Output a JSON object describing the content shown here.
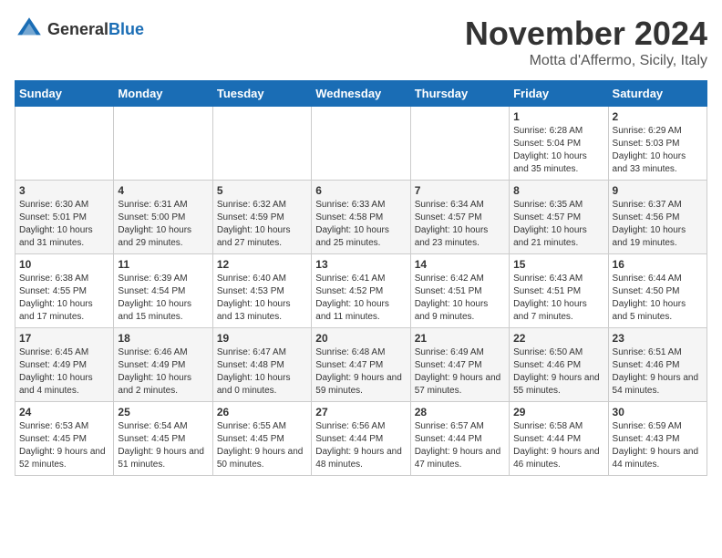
{
  "header": {
    "logo_general": "General",
    "logo_blue": "Blue",
    "month_title": "November 2024",
    "location": "Motta d'Affermo, Sicily, Italy"
  },
  "days_of_week": [
    "Sunday",
    "Monday",
    "Tuesday",
    "Wednesday",
    "Thursday",
    "Friday",
    "Saturday"
  ],
  "weeks": [
    [
      {
        "day": "",
        "sunrise": "",
        "sunset": "",
        "daylight": ""
      },
      {
        "day": "",
        "sunrise": "",
        "sunset": "",
        "daylight": ""
      },
      {
        "day": "",
        "sunrise": "",
        "sunset": "",
        "daylight": ""
      },
      {
        "day": "",
        "sunrise": "",
        "sunset": "",
        "daylight": ""
      },
      {
        "day": "",
        "sunrise": "",
        "sunset": "",
        "daylight": ""
      },
      {
        "day": "1",
        "sunrise": "Sunrise: 6:28 AM",
        "sunset": "Sunset: 5:04 PM",
        "daylight": "Daylight: 10 hours and 35 minutes."
      },
      {
        "day": "2",
        "sunrise": "Sunrise: 6:29 AM",
        "sunset": "Sunset: 5:03 PM",
        "daylight": "Daylight: 10 hours and 33 minutes."
      }
    ],
    [
      {
        "day": "3",
        "sunrise": "Sunrise: 6:30 AM",
        "sunset": "Sunset: 5:01 PM",
        "daylight": "Daylight: 10 hours and 31 minutes."
      },
      {
        "day": "4",
        "sunrise": "Sunrise: 6:31 AM",
        "sunset": "Sunset: 5:00 PM",
        "daylight": "Daylight: 10 hours and 29 minutes."
      },
      {
        "day": "5",
        "sunrise": "Sunrise: 6:32 AM",
        "sunset": "Sunset: 4:59 PM",
        "daylight": "Daylight: 10 hours and 27 minutes."
      },
      {
        "day": "6",
        "sunrise": "Sunrise: 6:33 AM",
        "sunset": "Sunset: 4:58 PM",
        "daylight": "Daylight: 10 hours and 25 minutes."
      },
      {
        "day": "7",
        "sunrise": "Sunrise: 6:34 AM",
        "sunset": "Sunset: 4:57 PM",
        "daylight": "Daylight: 10 hours and 23 minutes."
      },
      {
        "day": "8",
        "sunrise": "Sunrise: 6:35 AM",
        "sunset": "Sunset: 4:57 PM",
        "daylight": "Daylight: 10 hours and 21 minutes."
      },
      {
        "day": "9",
        "sunrise": "Sunrise: 6:37 AM",
        "sunset": "Sunset: 4:56 PM",
        "daylight": "Daylight: 10 hours and 19 minutes."
      }
    ],
    [
      {
        "day": "10",
        "sunrise": "Sunrise: 6:38 AM",
        "sunset": "Sunset: 4:55 PM",
        "daylight": "Daylight: 10 hours and 17 minutes."
      },
      {
        "day": "11",
        "sunrise": "Sunrise: 6:39 AM",
        "sunset": "Sunset: 4:54 PM",
        "daylight": "Daylight: 10 hours and 15 minutes."
      },
      {
        "day": "12",
        "sunrise": "Sunrise: 6:40 AM",
        "sunset": "Sunset: 4:53 PM",
        "daylight": "Daylight: 10 hours and 13 minutes."
      },
      {
        "day": "13",
        "sunrise": "Sunrise: 6:41 AM",
        "sunset": "Sunset: 4:52 PM",
        "daylight": "Daylight: 10 hours and 11 minutes."
      },
      {
        "day": "14",
        "sunrise": "Sunrise: 6:42 AM",
        "sunset": "Sunset: 4:51 PM",
        "daylight": "Daylight: 10 hours and 9 minutes."
      },
      {
        "day": "15",
        "sunrise": "Sunrise: 6:43 AM",
        "sunset": "Sunset: 4:51 PM",
        "daylight": "Daylight: 10 hours and 7 minutes."
      },
      {
        "day": "16",
        "sunrise": "Sunrise: 6:44 AM",
        "sunset": "Sunset: 4:50 PM",
        "daylight": "Daylight: 10 hours and 5 minutes."
      }
    ],
    [
      {
        "day": "17",
        "sunrise": "Sunrise: 6:45 AM",
        "sunset": "Sunset: 4:49 PM",
        "daylight": "Daylight: 10 hours and 4 minutes."
      },
      {
        "day": "18",
        "sunrise": "Sunrise: 6:46 AM",
        "sunset": "Sunset: 4:49 PM",
        "daylight": "Daylight: 10 hours and 2 minutes."
      },
      {
        "day": "19",
        "sunrise": "Sunrise: 6:47 AM",
        "sunset": "Sunset: 4:48 PM",
        "daylight": "Daylight: 10 hours and 0 minutes."
      },
      {
        "day": "20",
        "sunrise": "Sunrise: 6:48 AM",
        "sunset": "Sunset: 4:47 PM",
        "daylight": "Daylight: 9 hours and 59 minutes."
      },
      {
        "day": "21",
        "sunrise": "Sunrise: 6:49 AM",
        "sunset": "Sunset: 4:47 PM",
        "daylight": "Daylight: 9 hours and 57 minutes."
      },
      {
        "day": "22",
        "sunrise": "Sunrise: 6:50 AM",
        "sunset": "Sunset: 4:46 PM",
        "daylight": "Daylight: 9 hours and 55 minutes."
      },
      {
        "day": "23",
        "sunrise": "Sunrise: 6:51 AM",
        "sunset": "Sunset: 4:46 PM",
        "daylight": "Daylight: 9 hours and 54 minutes."
      }
    ],
    [
      {
        "day": "24",
        "sunrise": "Sunrise: 6:53 AM",
        "sunset": "Sunset: 4:45 PM",
        "daylight": "Daylight: 9 hours and 52 minutes."
      },
      {
        "day": "25",
        "sunrise": "Sunrise: 6:54 AM",
        "sunset": "Sunset: 4:45 PM",
        "daylight": "Daylight: 9 hours and 51 minutes."
      },
      {
        "day": "26",
        "sunrise": "Sunrise: 6:55 AM",
        "sunset": "Sunset: 4:45 PM",
        "daylight": "Daylight: 9 hours and 50 minutes."
      },
      {
        "day": "27",
        "sunrise": "Sunrise: 6:56 AM",
        "sunset": "Sunset: 4:44 PM",
        "daylight": "Daylight: 9 hours and 48 minutes."
      },
      {
        "day": "28",
        "sunrise": "Sunrise: 6:57 AM",
        "sunset": "Sunset: 4:44 PM",
        "daylight": "Daylight: 9 hours and 47 minutes."
      },
      {
        "day": "29",
        "sunrise": "Sunrise: 6:58 AM",
        "sunset": "Sunset: 4:44 PM",
        "daylight": "Daylight: 9 hours and 46 minutes."
      },
      {
        "day": "30",
        "sunrise": "Sunrise: 6:59 AM",
        "sunset": "Sunset: 4:43 PM",
        "daylight": "Daylight: 9 hours and 44 minutes."
      }
    ]
  ]
}
